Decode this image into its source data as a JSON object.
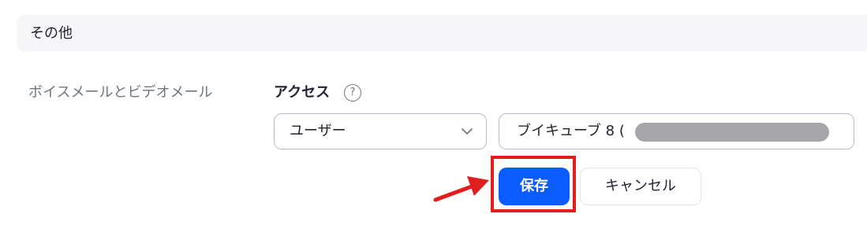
{
  "section": {
    "title": "その他"
  },
  "row": {
    "label": "ボイスメールとビデオメール"
  },
  "access": {
    "label": "アクセス",
    "help_glyph": "?"
  },
  "select": {
    "value": "ユーザー",
    "icon": "chevron-down-icon"
  },
  "user_field": {
    "value": "ブイキューブ 8 ("
  },
  "buttons": {
    "save_label": "保存",
    "cancel_label": "キャンセル"
  },
  "colors": {
    "primary": "#0b5cff",
    "annotation": "#e01e1e",
    "redaction": "#a6a6ab"
  }
}
